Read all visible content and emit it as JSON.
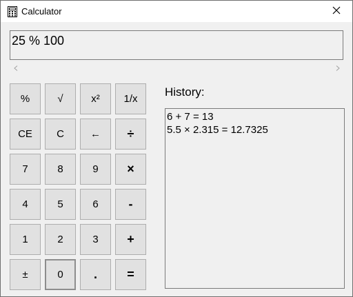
{
  "window": {
    "title": "Calculator"
  },
  "display": {
    "value": "25 % 100"
  },
  "keypad": {
    "keys": [
      {
        "name": "percent-key",
        "label": "%"
      },
      {
        "name": "sqrt-key",
        "label": "√"
      },
      {
        "name": "square-key",
        "label": "x²"
      },
      {
        "name": "reciprocal-key",
        "label": "1/x"
      },
      {
        "name": "clear-entry-key",
        "label": "CE"
      },
      {
        "name": "clear-key",
        "label": "C"
      },
      {
        "name": "backspace-key",
        "label": "←"
      },
      {
        "name": "divide-key",
        "label": "÷"
      },
      {
        "name": "digit-7-key",
        "label": "7"
      },
      {
        "name": "digit-8-key",
        "label": "8"
      },
      {
        "name": "digit-9-key",
        "label": "9"
      },
      {
        "name": "multiply-key",
        "label": "×"
      },
      {
        "name": "digit-4-key",
        "label": "4"
      },
      {
        "name": "digit-5-key",
        "label": "5"
      },
      {
        "name": "digit-6-key",
        "label": "6"
      },
      {
        "name": "subtract-key",
        "label": "-"
      },
      {
        "name": "digit-1-key",
        "label": "1"
      },
      {
        "name": "digit-2-key",
        "label": "2"
      },
      {
        "name": "digit-3-key",
        "label": "3"
      },
      {
        "name": "add-key",
        "label": "+"
      },
      {
        "name": "negate-key",
        "label": "±"
      },
      {
        "name": "digit-0-key",
        "label": "0"
      },
      {
        "name": "decimal-key",
        "label": "."
      },
      {
        "name": "equals-key",
        "label": "="
      }
    ]
  },
  "history": {
    "label": "History:",
    "entries": [
      "6 + 7 = 13",
      "5.5 × 2.315 = 12.7325"
    ]
  },
  "icons": {
    "app": "calculator-icon",
    "close": "close-icon",
    "scroll_left": "chevron-left-icon",
    "scroll_right": "chevron-right-icon"
  }
}
